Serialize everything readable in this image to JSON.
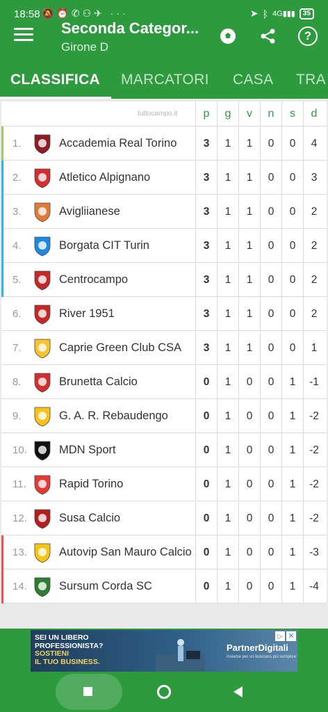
{
  "status_bar": {
    "time": "18:58",
    "battery": "35",
    "network": "4G"
  },
  "app_bar": {
    "title": "Seconda Categor...",
    "subtitle": "Girone D",
    "icons": [
      "menu-icon",
      "soccer-ball-icon",
      "share-icon",
      "help-icon"
    ],
    "help_glyph": "?"
  },
  "tabs": [
    "CLASSIFICA",
    "MARCATORI",
    "CASA",
    "TRA"
  ],
  "table": {
    "brand": "tuttocampo.it",
    "columns": [
      "p",
      "g",
      "v",
      "n",
      "s",
      "d"
    ],
    "rows": [
      {
        "pos": "1.",
        "team": "Accademia Real Torino",
        "p": "3",
        "g": "1",
        "v": "1",
        "n": "0",
        "s": "0",
        "d": "4",
        "bar": "#9ccc65",
        "logo": "#8b1e24"
      },
      {
        "pos": "2.",
        "team": "Atletico Alpignano",
        "p": "3",
        "g": "1",
        "v": "1",
        "n": "0",
        "s": "0",
        "d": "3",
        "bar": "#29b6f6",
        "logo": "#d32f2f"
      },
      {
        "pos": "3.",
        "team": "Avigliianese",
        "p": "3",
        "g": "1",
        "v": "1",
        "n": "0",
        "s": "0",
        "d": "2",
        "bar": "#29b6f6",
        "logo": "#e07b39"
      },
      {
        "pos": "4.",
        "team": "Borgata CIT Turin",
        "p": "3",
        "g": "1",
        "v": "1",
        "n": "0",
        "s": "0",
        "d": "2",
        "bar": "#29b6f6",
        "logo": "#1e88e5"
      },
      {
        "pos": "5.",
        "team": "Centrocampo",
        "p": "3",
        "g": "1",
        "v": "1",
        "n": "0",
        "s": "0",
        "d": "2",
        "bar": "#29b6f6",
        "logo": "#c62828"
      },
      {
        "pos": "6.",
        "team": "River 1951",
        "p": "3",
        "g": "1",
        "v": "1",
        "n": "0",
        "s": "0",
        "d": "2",
        "bar": "",
        "logo": "#c62828"
      },
      {
        "pos": "7.",
        "team": "Caprie Green Club CSA",
        "p": "3",
        "g": "1",
        "v": "1",
        "n": "0",
        "s": "0",
        "d": "1",
        "bar": "",
        "logo": "#f9c22e"
      },
      {
        "pos": "8.",
        "team": "Brunetta Calcio",
        "p": "0",
        "g": "1",
        "v": "0",
        "n": "0",
        "s": "1",
        "d": "-1",
        "bar": "",
        "logo": "#d32f2f"
      },
      {
        "pos": "9.",
        "team": "G. A. R. Rebaudengo",
        "p": "0",
        "g": "1",
        "v": "0",
        "n": "0",
        "s": "1",
        "d": "-2",
        "bar": "",
        "logo": "#f6c21b"
      },
      {
        "pos": "10.",
        "team": "MDN Sport",
        "p": "0",
        "g": "1",
        "v": "0",
        "n": "0",
        "s": "1",
        "d": "-2",
        "bar": "",
        "logo": "#111111"
      },
      {
        "pos": "11.",
        "team": "Rapid Torino",
        "p": "0",
        "g": "1",
        "v": "0",
        "n": "0",
        "s": "1",
        "d": "-2",
        "bar": "",
        "logo": "#e53935"
      },
      {
        "pos": "12.",
        "team": "Susa Calcio",
        "p": "0",
        "g": "1",
        "v": "0",
        "n": "0",
        "s": "1",
        "d": "-2",
        "bar": "",
        "logo": "#b71c1c"
      },
      {
        "pos": "13.",
        "team": "Autovip San Mauro Calcio",
        "p": "0",
        "g": "1",
        "v": "0",
        "n": "0",
        "s": "1",
        "d": "-3",
        "bar": "#ef5350",
        "logo": "#f5c518"
      },
      {
        "pos": "14.",
        "team": "Sursum Corda SC",
        "p": "0",
        "g": "1",
        "v": "0",
        "n": "0",
        "s": "1",
        "d": "-4",
        "bar": "#ef5350",
        "logo": "#2e7d32"
      }
    ]
  },
  "ad": {
    "line1": "SEI UN LIBERO",
    "line2": "PROFESSIONISTA?",
    "line3": "SOSTIENI",
    "line4": "IL TUO BUSINESS.",
    "brand": "PartnerDigitali",
    "brand_sub": "Insieme per un business più semplice",
    "close": "✕",
    "play": "▷"
  },
  "colors": {
    "brand": "#2c9a3d",
    "promotion": "#29b6f6",
    "leader": "#9ccc65",
    "relegation": "#ef5350"
  }
}
